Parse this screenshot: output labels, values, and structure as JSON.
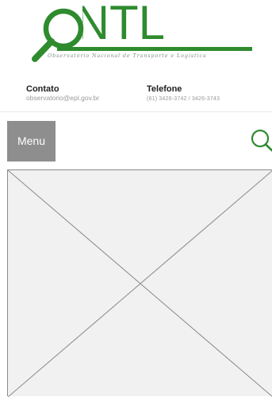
{
  "header": {
    "logo": {
      "text": "ONTL",
      "subtitle": "Observatório Nacional de Transporte e Logística",
      "brand_color": "#2e8b2e",
      "icon": "magnifier-logo-icon"
    },
    "contact": {
      "label": "Contato",
      "value": "observatorio@epl.gov.br"
    },
    "phone": {
      "label": "Telefone",
      "value": "(61) 3426-3742 / 3426-3743"
    }
  },
  "nav": {
    "menu_label": "Menu",
    "menu_bg": "#8e8e8e",
    "search_icon": "search-icon",
    "search_color": "#2e8b2e"
  },
  "main": {
    "image_placeholder": "image-placeholder-icon",
    "placeholder_bg": "#f1f1f1"
  }
}
